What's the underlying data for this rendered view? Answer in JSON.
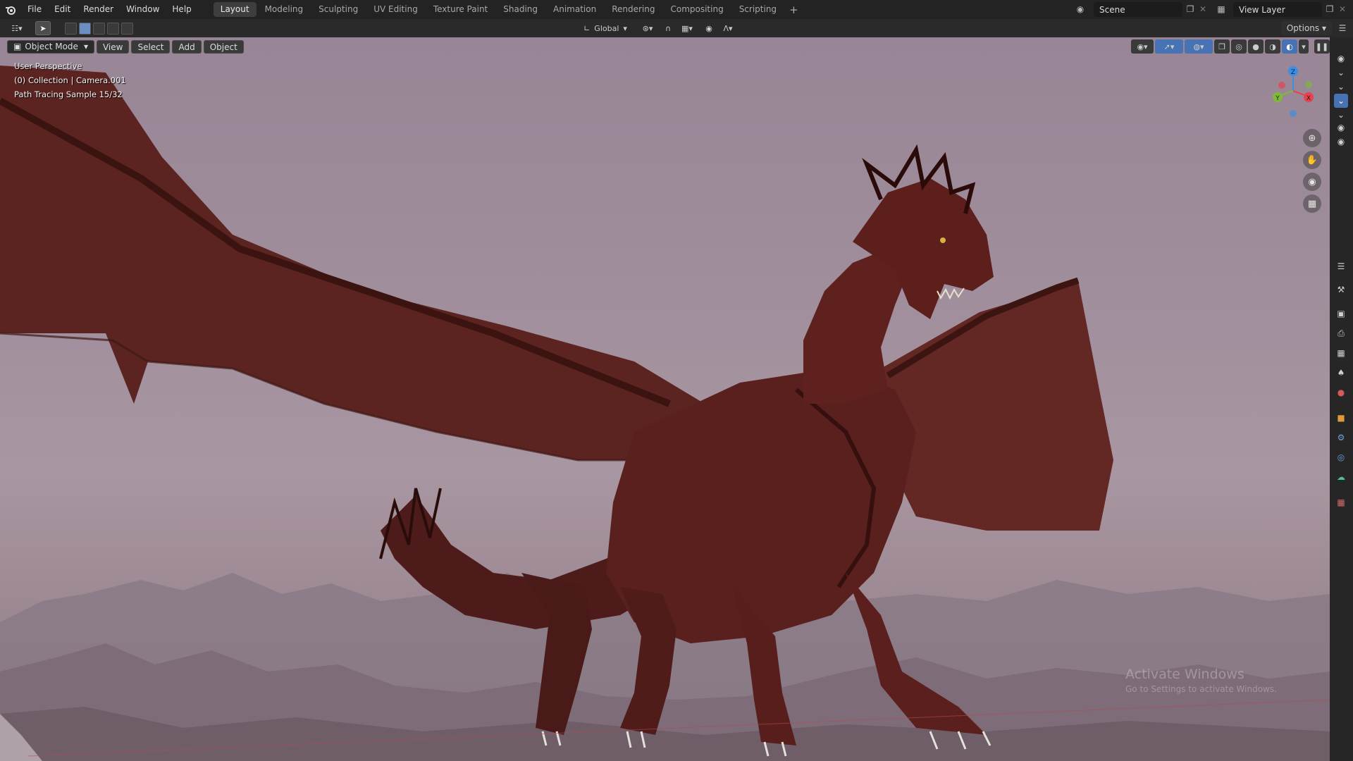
{
  "menu": [
    "File",
    "Edit",
    "Render",
    "Window",
    "Help"
  ],
  "workspaces": [
    {
      "label": "Layout",
      "active": true
    },
    {
      "label": "Modeling",
      "active": false
    },
    {
      "label": "Sculpting",
      "active": false
    },
    {
      "label": "UV Editing",
      "active": false
    },
    {
      "label": "Texture Paint",
      "active": false
    },
    {
      "label": "Shading",
      "active": false
    },
    {
      "label": "Animation",
      "active": false
    },
    {
      "label": "Rendering",
      "active": false
    },
    {
      "label": "Compositing",
      "active": false
    },
    {
      "label": "Scripting",
      "active": false
    }
  ],
  "add_workspace": "+",
  "scene": {
    "name": "Scene"
  },
  "view_layer": {
    "name": "View Layer"
  },
  "toolbar": {
    "orientation": "Global",
    "options_label": "Options"
  },
  "viewport": {
    "mode_label": "Object Mode",
    "menus": [
      "View",
      "Select",
      "Add",
      "Object"
    ],
    "info": {
      "perspective": "User Perspective",
      "collection": "(0) Collection | Camera.001",
      "render_status": "Path Tracing Sample 15/32"
    },
    "gizmo": {
      "z": "Z",
      "y": "Y",
      "x": "X"
    },
    "watermark": {
      "title": "Activate Windows",
      "subtitle": "Go to Settings to activate Windows."
    }
  },
  "colors": {
    "accent": "#4772b3",
    "axis_x": "#e4434f",
    "axis_y": "#7fb83a",
    "axis_z": "#3d8fe4",
    "dragon": "#5a1f1c"
  }
}
